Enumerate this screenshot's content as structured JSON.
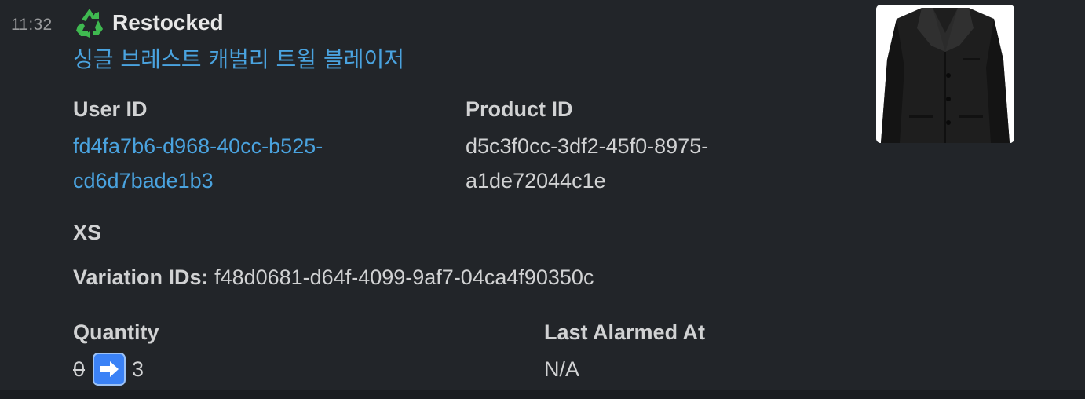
{
  "message": {
    "timestamp": "11:32",
    "icon": "recycle-icon",
    "title": "Restocked",
    "product_name": "싱글 브레스트 캐벌리 트윌 블레이저"
  },
  "fields": {
    "user_id": {
      "label": "User ID",
      "value_line1": "fd4fa7b6-d968-40cc-b525-",
      "value_line2": "cd6d7bade1b3"
    },
    "product_id": {
      "label": "Product ID",
      "value_line1": "d5c3f0cc-3df2-45f0-8975-",
      "value_line2": "a1de72044c1e"
    },
    "size": "XS",
    "variation": {
      "label": "Variation IDs:",
      "value": "f48d0681-d64f-4099-9af7-04ca4f90350c"
    },
    "quantity": {
      "label": "Quantity",
      "old": "0",
      "arrow_icon": "right-arrow-icon",
      "new": "3"
    },
    "last_alarmed": {
      "label": "Last Alarmed At",
      "value": "N/A"
    }
  },
  "thumbnail": {
    "icon": "blazer-image"
  },
  "colors": {
    "background": "#222529",
    "link": "#4aa3df",
    "text": "#d1d2d3",
    "recycle": "#3fb950",
    "arrow_button": "#3b82f6"
  }
}
